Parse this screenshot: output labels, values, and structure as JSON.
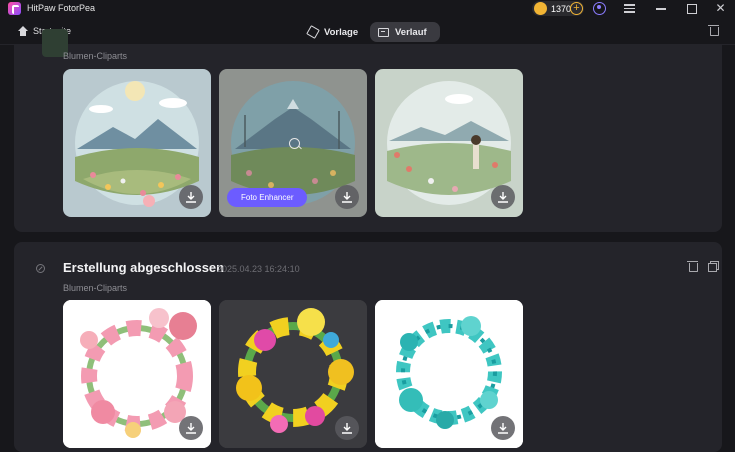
{
  "app": {
    "title": "HitPaw FotorPea",
    "credits": "1370"
  },
  "nav": {
    "home_label": "Startseite",
    "tabs": [
      {
        "label": "Vorlage"
      },
      {
        "label": "Verlauf"
      }
    ]
  },
  "history": [
    {
      "category": "Blumen-Cliparts",
      "images": [
        {
          "subject": "mountain-meadow-flowers",
          "hover_action": ""
        },
        {
          "subject": "volcano-flower-field",
          "hover_action": "Foto Enhancer"
        },
        {
          "subject": "girl-in-flower-meadow",
          "hover_action": ""
        }
      ]
    },
    {
      "status_title": "Erstellung abgeschlossen",
      "timestamp": "2025.04.23 16:24:10",
      "category": "Blumen-Cliparts",
      "images": [
        {
          "subject": "pink-flower-wreath"
        },
        {
          "subject": "colorful-flower-wreath"
        },
        {
          "subject": "turquoise-flower-wreath"
        }
      ]
    }
  ],
  "colors": {
    "accent": "#6c5cff",
    "coin": "#f1b434",
    "background": "#17171b",
    "card": "#24242a"
  }
}
